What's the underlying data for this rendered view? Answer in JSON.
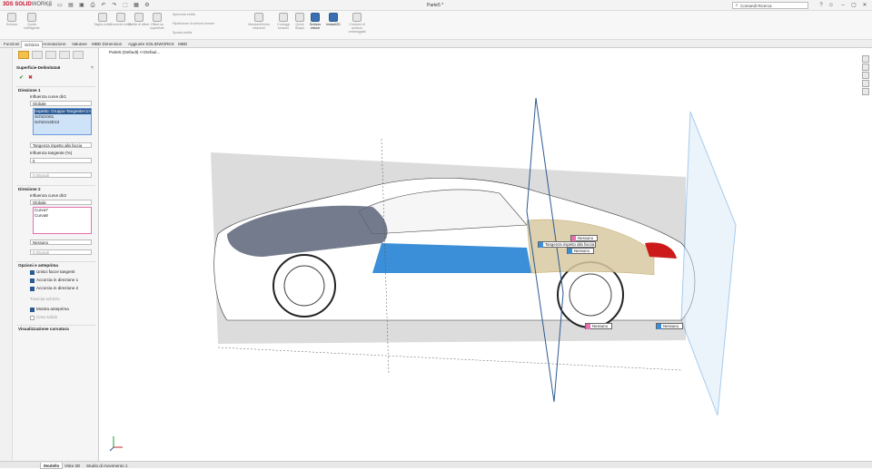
{
  "app": {
    "logo_brand": "3DS SOLID",
    "logo_suffix": "WORKS",
    "document_title": "Parte5 *"
  },
  "search": {
    "placeholder": "Comandi Ricerca"
  },
  "commands": [
    {
      "label": "Schizzo"
    },
    {
      "label": "Quota intelligente"
    },
    {
      "label": "Taglia entità"
    },
    {
      "label": "Converti entità"
    },
    {
      "label": "Entità di offset"
    },
    {
      "label": "Offset su superficie"
    },
    {
      "label": "Specchia entità"
    },
    {
      "label": "Ripetizione di schizzo lineare"
    },
    {
      "label": "Sposta entità"
    },
    {
      "label": "Mostra/elimina relazioni"
    },
    {
      "label": "Correggi schizzo"
    },
    {
      "label": "Quick Snaps"
    },
    {
      "label": "Schizzo veloce"
    },
    {
      "label": "Instant2D"
    },
    {
      "label": "Contorni di schizzo ombreggiati"
    }
  ],
  "tabs": [
    "Funzioni",
    "Schizzo",
    "Annotazione",
    "Valutare",
    "MBD Dimension",
    "Aggiunte SOLIDWORKS",
    "MBD"
  ],
  "selected_tab": "Schizzo",
  "feature_tree": {
    "breadcrumb": "Parte5 (Default) <<Defaul..."
  },
  "pm": {
    "title": "Superficie-Delimitata6",
    "ok": "✔",
    "cancel": "✖",
    "dir1": {
      "header": "Direzione 1",
      "influence_label": "Influenza curve dir1",
      "influence_value": "Globale",
      "items": [
        "Aspetto: Gruppo-Tangente<1>",
        "Schizzo51",
        "Schizzo3D13"
      ],
      "tangency": "Tangenza rispetto alla faccia",
      "tangent_influence_label": "Influenza tangente (%)",
      "tangent_value": "0",
      "angle_value": "0,00gradi"
    },
    "dir2": {
      "header": "Direzione 2",
      "influence_label": "Influenza curve dir2",
      "influence_value": "Globale",
      "items": [
        "Curva7",
        "Curva8"
      ],
      "tangency": "Nessuno",
      "angle_value": "0,00gradi"
    },
    "options": {
      "header": "Opzioni e anteprima",
      "items": [
        {
          "label": "Unisci facce tangenti",
          "checked": true
        },
        {
          "label": "Accorcia in direzione 1",
          "checked": true
        },
        {
          "label": "Accorcia in direzione 2",
          "checked": true
        }
      ],
      "trim_sketch": "Tranciia schizzo",
      "show_preview": "Mostra anteprima",
      "create_solid": "Crea solido"
    },
    "curvature": {
      "header": "Visualizzazione curvatura"
    }
  },
  "callouts": {
    "a": "Nessuno",
    "b": "Tangenza rispetto alla faccia",
    "c": "Nessuno",
    "d": "Nessuno",
    "e": "Nessuno"
  },
  "bottom_tabs": [
    "Modello",
    "Viste 3D",
    "Studio di movimento 1"
  ],
  "selected_bottom_tab": "Modello",
  "colors": {
    "accent": "#2c5a93",
    "pink": "#e86fb0",
    "cyan": "#3b8fd8",
    "brand": "#c8102e"
  }
}
